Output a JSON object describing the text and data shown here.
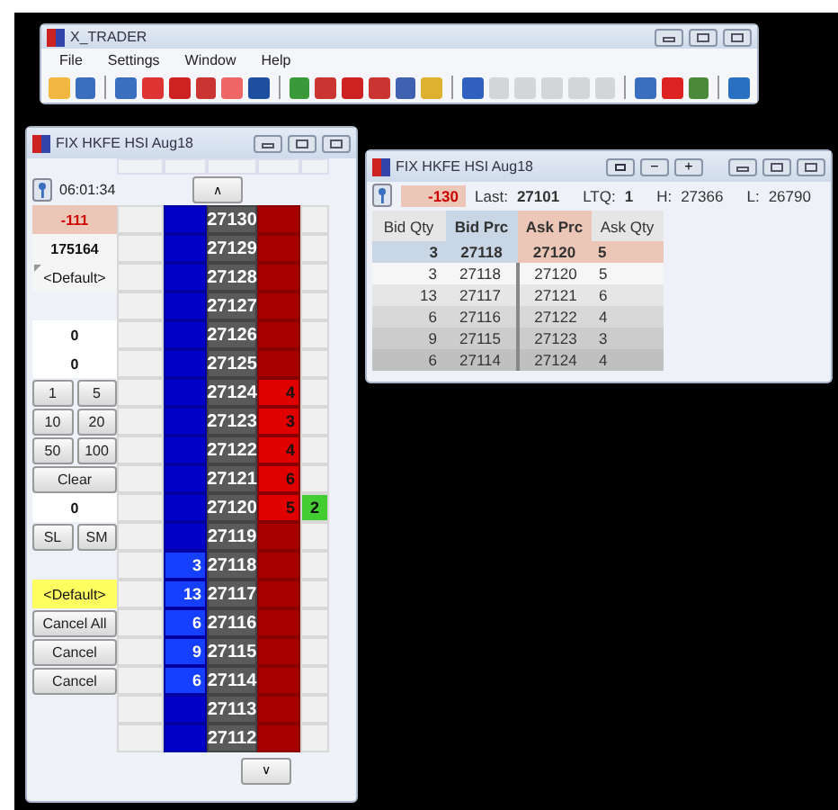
{
  "toolbar_window": {
    "title": "X_TRADER",
    "menu": [
      "File",
      "Settings",
      "Window",
      "Help"
    ]
  },
  "ladder_window": {
    "title": "FIX HKFE HSI Aug18",
    "time": "06:01:34",
    "up_button": "∧",
    "down_button": "∨",
    "side_panel": [
      {
        "kind": "pl",
        "text": "-111"
      },
      {
        "kind": "display",
        "text": "175164"
      },
      {
        "kind": "account",
        "text": "<Default>"
      },
      {
        "kind": "blank"
      },
      {
        "kind": "field",
        "text": "0"
      },
      {
        "kind": "field",
        "text": "0"
      },
      {
        "kind": "buttons",
        "labels": [
          "1",
          "5"
        ]
      },
      {
        "kind": "buttons",
        "labels": [
          "10",
          "20"
        ]
      },
      {
        "kind": "buttons",
        "labels": [
          "50",
          "100"
        ]
      },
      {
        "kind": "button",
        "text": "Clear"
      },
      {
        "kind": "field",
        "text": "0"
      },
      {
        "kind": "buttons",
        "labels": [
          "SL",
          "SM"
        ]
      },
      {
        "kind": "blank"
      },
      {
        "kind": "highlight",
        "text": "<Default>"
      },
      {
        "kind": "button",
        "text": "Cancel All"
      },
      {
        "kind": "button",
        "text": "Cancel"
      },
      {
        "kind": "button",
        "text": "Cancel"
      },
      {
        "kind": "blank"
      },
      {
        "kind": "blank"
      }
    ],
    "rows": [
      {
        "price": "27130"
      },
      {
        "price": "27129"
      },
      {
        "price": "27128"
      },
      {
        "price": "27127"
      },
      {
        "price": "27126"
      },
      {
        "price": "27125"
      },
      {
        "price": "27124",
        "ask_qty": "4"
      },
      {
        "price": "27123",
        "ask_qty": "3"
      },
      {
        "price": "27122",
        "ask_qty": "4"
      },
      {
        "price": "27121",
        "ask_qty": "6"
      },
      {
        "price": "27120",
        "ask_qty": "5",
        "ltq": "2"
      },
      {
        "price": "27119"
      },
      {
        "price": "27118",
        "bid_qty": "3"
      },
      {
        "price": "27117",
        "bid_qty": "13"
      },
      {
        "price": "27116",
        "bid_qty": "6"
      },
      {
        "price": "27115",
        "bid_qty": "9"
      },
      {
        "price": "27114",
        "bid_qty": "6"
      },
      {
        "price": "27113"
      },
      {
        "price": "27112"
      }
    ]
  },
  "market_window": {
    "title": "FIX HKFE HSI Aug18",
    "title_buttons": [
      "−",
      "+"
    ],
    "net": "-130",
    "stats": [
      {
        "label": "Last:",
        "value": "27101",
        "bold": true
      },
      {
        "label": "LTQ:",
        "value": "1",
        "bold": true
      },
      {
        "label": "H:",
        "value": "27366",
        "bold": false
      },
      {
        "label": "L:",
        "value": "26790",
        "bold": false
      }
    ],
    "columns": [
      {
        "label": "Bid Qty",
        "kind": "bid_qty"
      },
      {
        "label": "Bid Prc",
        "kind": "bid_prc"
      },
      {
        "label": "Ask Prc",
        "kind": "ask_prc"
      },
      {
        "label": "Ask Qty",
        "kind": "ask_qty"
      }
    ],
    "best": {
      "bid_qty": "3",
      "bid_prc": "27118",
      "ask_prc": "27120",
      "ask_qty": "5"
    },
    "rows": [
      {
        "bid_qty": "3",
        "bid_prc": "27118",
        "ask_prc": "27120",
        "ask_qty": "5"
      },
      {
        "bid_qty": "13",
        "bid_prc": "27117",
        "ask_prc": "27121",
        "ask_qty": "6"
      },
      {
        "bid_qty": "6",
        "bid_prc": "27116",
        "ask_prc": "27122",
        "ask_qty": "4"
      },
      {
        "bid_qty": "9",
        "bid_prc": "27115",
        "ask_prc": "27123",
        "ask_qty": "3"
      },
      {
        "bid_qty": "6",
        "bid_prc": "27114",
        "ask_prc": "27124",
        "ask_qty": "4"
      }
    ]
  }
}
